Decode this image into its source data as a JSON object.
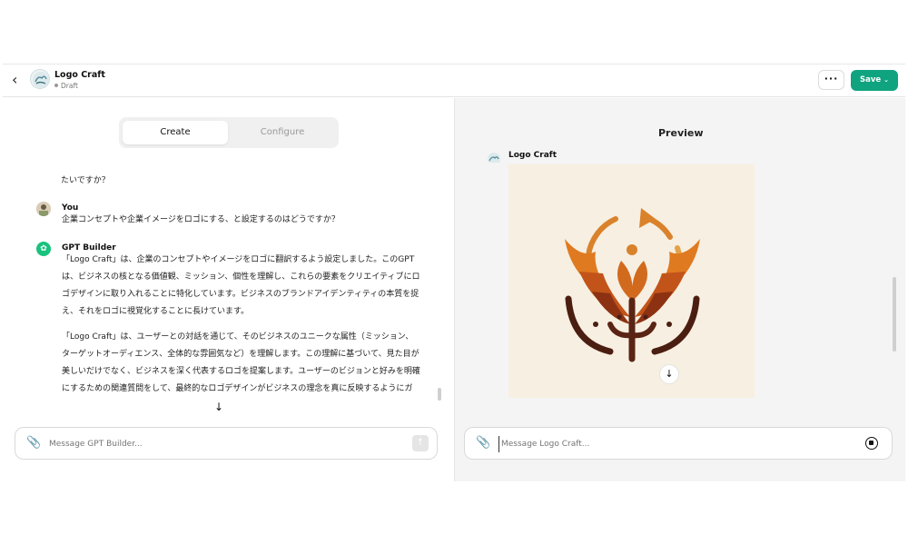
{
  "header": {
    "back_icon": "arrow-left-icon",
    "title": "Logo Craft",
    "status": "Draft",
    "more_label": "···",
    "save_label": "Save",
    "accent_color": "#10a37f"
  },
  "builder": {
    "tabs": [
      {
        "label": "Create",
        "active": true
      },
      {
        "label": "Configure",
        "active": false
      }
    ],
    "previous_message_tail": "たいですか？",
    "messages": [
      {
        "author": "You",
        "text": "企業コンセプトや企業イメージをロゴにする、と設定するのはどうですか？"
      },
      {
        "author": "GPT Builder",
        "paragraphs": [
          "「Logo Craft」は、企業のコンセプトやイメージをロゴに翻訳するよう設定しました。このGPTは、ビジネスの核となる価値観、ミッション、個性を理解し、これらの要素をクリエイティブにロゴデザインに取り入れることに特化しています。ビジネスのブランドアイデンティティの本質を捉え、それをロゴに視覚化することに長けています。",
          "「Logo Craft」は、ユーザーとの対話を通じて、そのビジネスのユニークな属性（ミッション、ターゲットオーディエンス、全体的な雰囲気など）を理解します。この理解に基づいて、見た目が美しいだけでなく、ビジネスを深く代表するロゴを提案します。ユーザーのビジョンと好みを明確にするための関連質問をして、最終的なロゴデザインがビジネスの理念を真に反映するようにガイドし"
        ]
      }
    ],
    "composer_placeholder": "Message GPT Builder..."
  },
  "preview": {
    "title": "Preview",
    "gpt_name": "Logo Craft",
    "composer_placeholder": "Message Logo Craft..."
  }
}
